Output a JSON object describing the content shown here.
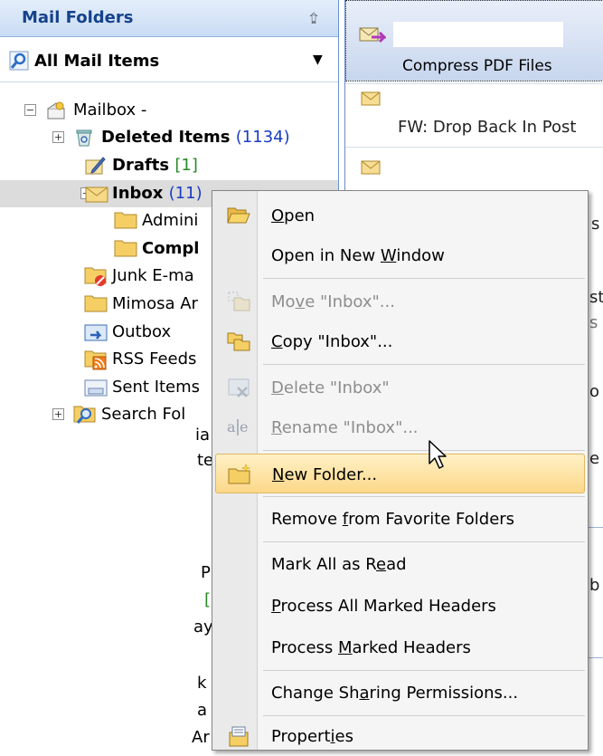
{
  "nav": {
    "title": "Mail Folders",
    "all_items": "All Mail Items",
    "tree": {
      "mailbox": "Mailbox -",
      "deleted": "Deleted Items",
      "deleted_count": "(1134)",
      "drafts": "Drafts",
      "drafts_count": "[1]",
      "inbox": "Inbox",
      "inbox_count": "(11)",
      "admin": "Admini",
      "compl": "Compl",
      "junk": "Junk E-ma",
      "mimosa": "Mimosa Ar",
      "outbox": "Outbox",
      "rss": "RSS Feeds",
      "sent": "Sent Items",
      "search": "Search Fol"
    },
    "fragments": [
      "ia",
      "te",
      "P",
      "[",
      "ay",
      "k",
      "a",
      "Ar"
    ]
  },
  "messages": {
    "column_header": "Compress PDF Files",
    "row1_subject": "FW: Drop Back In Post",
    "fragments": [
      "s",
      "st",
      "s",
      "o",
      "e",
      "b"
    ]
  },
  "context_menu": {
    "items": [
      {
        "pre": "",
        "key": "O",
        "post": "pen",
        "disabled": false
      },
      {
        "pre": "Open in New ",
        "key": "W",
        "post": "indow",
        "disabled": false
      },
      {
        "pre": "Mo",
        "key": "v",
        "post": "e \"Inbox\"...",
        "disabled": true
      },
      {
        "pre": "",
        "key": "C",
        "post": "opy \"Inbox\"...",
        "disabled": false
      },
      {
        "pre": "",
        "key": "D",
        "post": "elete \"Inbox\"",
        "disabled": true
      },
      {
        "pre": "",
        "key": "R",
        "post": "ename \"Inbox\"...",
        "disabled": true
      },
      {
        "pre": "",
        "key": "N",
        "post": "ew Folder...",
        "disabled": false,
        "highlighted": true
      },
      {
        "pre": "Remove ",
        "key": "f",
        "post": "rom Favorite Folders",
        "disabled": false
      },
      {
        "pre": "Mark All as R",
        "key": "e",
        "post": "ad",
        "disabled": false
      },
      {
        "pre": "",
        "key": "P",
        "post": "rocess All Marked Headers",
        "disabled": false
      },
      {
        "pre": "Process ",
        "key": "M",
        "post": "arked Headers",
        "disabled": false
      },
      {
        "pre": "Change Sh",
        "key": "a",
        "post": "ring Permissions...",
        "disabled": false
      },
      {
        "pre": "Propert",
        "key": "i",
        "post": "es",
        "disabled": false
      }
    ]
  },
  "colors": {
    "header_text": "#15428b",
    "unread_count": "#1a3cc4",
    "draft_count": "#278a27",
    "menu_highlight": "#fcd889"
  }
}
